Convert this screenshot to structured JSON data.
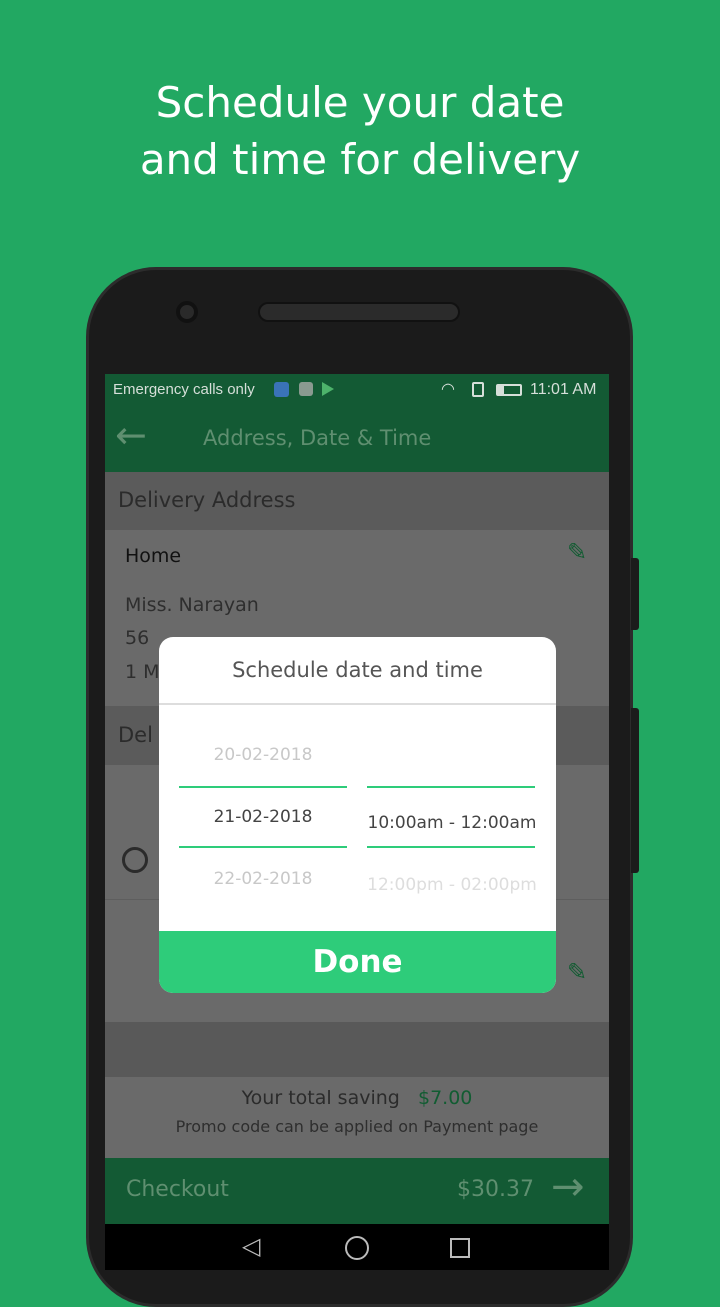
{
  "headline": "Schedule your date and time for delivery",
  "status_bar": {
    "carrier": "Emergency calls only",
    "time": "11:01 AM"
  },
  "app_bar": {
    "title": "Address, Date & Time"
  },
  "delivery_address": {
    "header": "Delivery Address",
    "label": "Home",
    "name": "Miss. Narayan",
    "line1": "56",
    "line2": "1 M"
  },
  "delivery_section": {
    "header_partial": "Del"
  },
  "dialog": {
    "title": "Schedule date and time",
    "dates": [
      "20-02-2018",
      "21-02-2018",
      "22-02-2018"
    ],
    "selected_date": "21-02-2018",
    "times": [
      "",
      "10:00am - 12:00am",
      "12:00pm - 02:00pm"
    ],
    "done_label": "Done"
  },
  "summary": {
    "saving_label": "Your total saving",
    "saving_value": "$7.00",
    "promo_note": "Promo code can be applied on Payment  page"
  },
  "checkout": {
    "label": "Checkout",
    "total": "$30.37"
  },
  "colors": {
    "background": "#22a862",
    "accent": "#2ecc7a",
    "app_bar": "#135a34"
  }
}
